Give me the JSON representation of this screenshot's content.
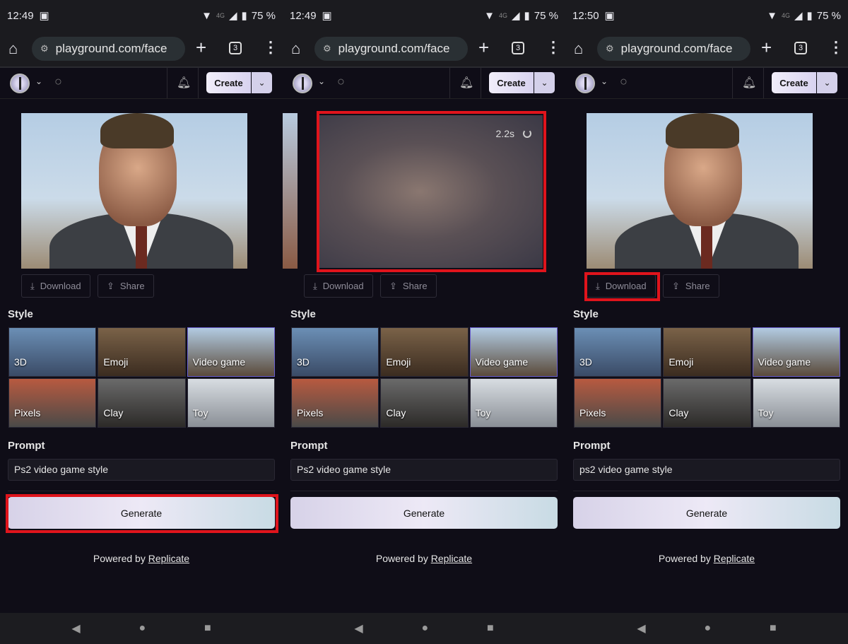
{
  "panels": [
    {
      "time": "12:49",
      "battery": "75 %",
      "network": "4G",
      "url": "playground.com/face",
      "tab_count": "3",
      "create_label": "Create",
      "timer": "",
      "download_label": "Download",
      "share_label": "Share",
      "style_label": "Style",
      "prompt_label": "Prompt",
      "prompt_value": "Ps2 video game style",
      "generate_label": "Generate",
      "powered_by": "Powered by",
      "replicate_link": "Replicate",
      "image_state": "result",
      "highlight": "generate"
    },
    {
      "time": "12:49",
      "battery": "75 %",
      "network": "4G",
      "url": "playground.com/face",
      "tab_count": "3",
      "create_label": "Create",
      "timer": "2.2s",
      "download_label": "Download",
      "share_label": "Share",
      "style_label": "Style",
      "prompt_label": "Prompt",
      "prompt_value": "Ps2 video game style",
      "generate_label": "Generate",
      "powered_by": "Powered by",
      "replicate_link": "Replicate",
      "image_state": "loading",
      "highlight": "image"
    },
    {
      "time": "12:50",
      "battery": "75 %",
      "network": "4G",
      "url": "playground.com/face",
      "tab_count": "3",
      "create_label": "Create",
      "timer": "",
      "download_label": "Download",
      "share_label": "Share",
      "style_label": "Style",
      "prompt_label": "Prompt",
      "prompt_value": "ps2 video game style",
      "generate_label": "Generate",
      "powered_by": "Powered by",
      "replicate_link": "Replicate",
      "image_state": "result",
      "highlight": "download"
    }
  ],
  "styles": [
    {
      "label": "3D",
      "colors": [
        "#6b8fb5",
        "#3a4b66"
      ]
    },
    {
      "label": "Emoji",
      "colors": [
        "#7a6248",
        "#3b2c20"
      ]
    },
    {
      "label": "Video game",
      "colors": [
        "#b2cbe2",
        "#5a4a3a"
      ],
      "selected": true
    },
    {
      "label": "Pixels",
      "colors": [
        "#b85a40",
        "#4a4a48"
      ]
    },
    {
      "label": "Clay",
      "colors": [
        "#6a6a6a",
        "#2c2a28"
      ]
    },
    {
      "label": "Toy",
      "colors": [
        "#d8dde2",
        "#8a8f96"
      ]
    }
  ],
  "accent": "#e0141c"
}
